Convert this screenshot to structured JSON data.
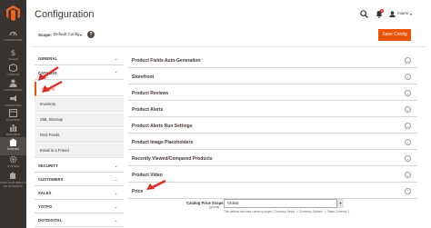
{
  "nav": {
    "items": [
      {
        "label": "DASHBOARD",
        "icon": "dashboard-icon"
      },
      {
        "label": "SALES",
        "icon": "dollar-icon"
      },
      {
        "label": "CATALOG",
        "icon": "cube-icon"
      },
      {
        "label": "CUSTOMERS",
        "icon": "person-icon"
      },
      {
        "label": "MARKETING",
        "icon": "megaphone-icon"
      },
      {
        "label": "CONTENT",
        "icon": "layout-icon"
      },
      {
        "label": "REPORTS",
        "icon": "bar-chart-icon"
      },
      {
        "label": "STORES",
        "icon": "store-icon"
      },
      {
        "label": "SYSTEM",
        "icon": "gear-icon"
      },
      {
        "label": "FIND PARTNERS & EXTENSIONS",
        "icon": "puzzle-icon"
      }
    ],
    "active_index": 7
  },
  "header": {
    "title": "Configuration",
    "notifications_count": "3",
    "user": "miumi"
  },
  "scope": {
    "label": "Scope:",
    "value": "Default Config",
    "help": "?"
  },
  "save_button": "Save Config",
  "tabs": {
    "groups": [
      {
        "label": "GENERAL",
        "caret": "⌄"
      },
      {
        "label": "CATALOG",
        "caret": "⌃"
      },
      {
        "label": "SECURITY",
        "caret": "⌄"
      },
      {
        "label": "CUSTOMERS",
        "caret": "⌄"
      },
      {
        "label": "SALES",
        "caret": "⌄"
      },
      {
        "label": "YOTPO",
        "caret": "⌄"
      },
      {
        "label": "DOTDIGITAL",
        "caret": "⌄"
      }
    ],
    "catalog_items": [
      {
        "label": "Catalog"
      },
      {
        "label": "Inventory"
      },
      {
        "label": "XML Sitemap"
      },
      {
        "label": "RSS Feeds"
      },
      {
        "label": "Email to a Friend"
      }
    ]
  },
  "sections": [
    {
      "title": "Product Fields Auto-Generation"
    },
    {
      "title": "Storefront"
    },
    {
      "title": "Product Reviews"
    },
    {
      "title": "Product Alerts"
    },
    {
      "title": "Product Alerts Run Settings"
    },
    {
      "title": "Product Image Placeholders"
    },
    {
      "title": "Recently Viewed/Compared Products"
    },
    {
      "title": "Product Video"
    },
    {
      "title": "Price"
    }
  ],
  "price": {
    "field_label": "Catalog Price Scope",
    "field_scope": "[global]",
    "value": "Global",
    "note": "This defines the base currency scope (\"Currency Setup\" > \"Currency Options\" > \"Base Currency\")."
  },
  "colors": {
    "accent": "#eb5202",
    "nav_bg": "#373330",
    "arrow": "#e02b27"
  }
}
